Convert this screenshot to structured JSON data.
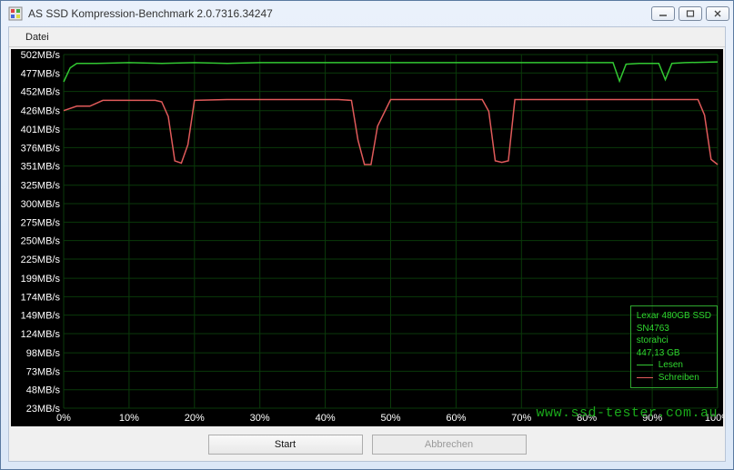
{
  "window": {
    "title": "AS SSD Kompression-Benchmark 2.0.7316.34247"
  },
  "menu": {
    "file": "Datei"
  },
  "footer": {
    "start_label": "Start",
    "cancel_label": "Abbrechen"
  },
  "legend": {
    "device": "Lexar 480GB SSD",
    "serial": "SN4763",
    "driver": "storahci",
    "capacity": "447,13 GB",
    "read_label": "Lesen",
    "write_label": "Schreiben",
    "read_color": "#32c832",
    "write_color": "#e05a5a"
  },
  "watermark": "www.ssd-tester.com.au",
  "chart_data": {
    "type": "line",
    "xlabel": "",
    "ylabel": "",
    "xlim": [
      0,
      100
    ],
    "ylim": [
      23,
      502
    ],
    "y_ticks": [
      502,
      477,
      452,
      426,
      401,
      376,
      351,
      325,
      300,
      275,
      250,
      225,
      199,
      174,
      149,
      124,
      98,
      73,
      48,
      23
    ],
    "y_tick_labels": [
      "502MB/s",
      "477MB/s",
      "452MB/s",
      "426MB/s",
      "401MB/s",
      "376MB/s",
      "351MB/s",
      "325MB/s",
      "300MB/s",
      "275MB/s",
      "250MB/s",
      "225MB/s",
      "199MB/s",
      "174MB/s",
      "149MB/s",
      "124MB/s",
      "98MB/s",
      "73MB/s",
      "48MB/s",
      "23MB/s"
    ],
    "x_ticks": [
      0,
      10,
      20,
      30,
      40,
      50,
      60,
      70,
      80,
      90,
      100
    ],
    "x_tick_labels": [
      "0%",
      "10%",
      "20%",
      "30%",
      "40%",
      "50%",
      "60%",
      "70%",
      "80%",
      "90%",
      "100%"
    ],
    "series": [
      {
        "name": "Lesen",
        "color": "#32c832",
        "x": [
          0,
          1,
          2,
          5,
          10,
          15,
          20,
          25,
          30,
          35,
          40,
          45,
          50,
          55,
          60,
          65,
          70,
          75,
          80,
          84,
          85,
          86,
          88,
          91,
          92,
          93,
          95,
          100
        ],
        "values": [
          465,
          484,
          490,
          490,
          491,
          490,
          491,
          490,
          491,
          491,
          491,
          491,
          491,
          491,
          491,
          491,
          491,
          491,
          491,
          491,
          466,
          489,
          490,
          490,
          468,
          490,
          491,
          492
        ]
      },
      {
        "name": "Schreiben",
        "color": "#e05a5a",
        "x": [
          0,
          2,
          4,
          6,
          8,
          10,
          12,
          14,
          15,
          16,
          17,
          18,
          19,
          20,
          25,
          30,
          35,
          40,
          42,
          44,
          45,
          46,
          47,
          48,
          50,
          55,
          60,
          63,
          64,
          65,
          66,
          67,
          68,
          69,
          70,
          72,
          75,
          80,
          85,
          90,
          95,
          97,
          98,
          99,
          100
        ],
        "values": [
          426,
          432,
          432,
          440,
          440,
          440,
          440,
          440,
          438,
          418,
          358,
          355,
          380,
          440,
          441,
          441,
          441,
          441,
          441,
          440,
          386,
          353,
          353,
          405,
          441,
          441,
          441,
          441,
          441,
          425,
          358,
          356,
          358,
          441,
          441,
          441,
          441,
          441,
          441,
          441,
          441,
          441,
          420,
          360,
          353
        ]
      }
    ]
  }
}
